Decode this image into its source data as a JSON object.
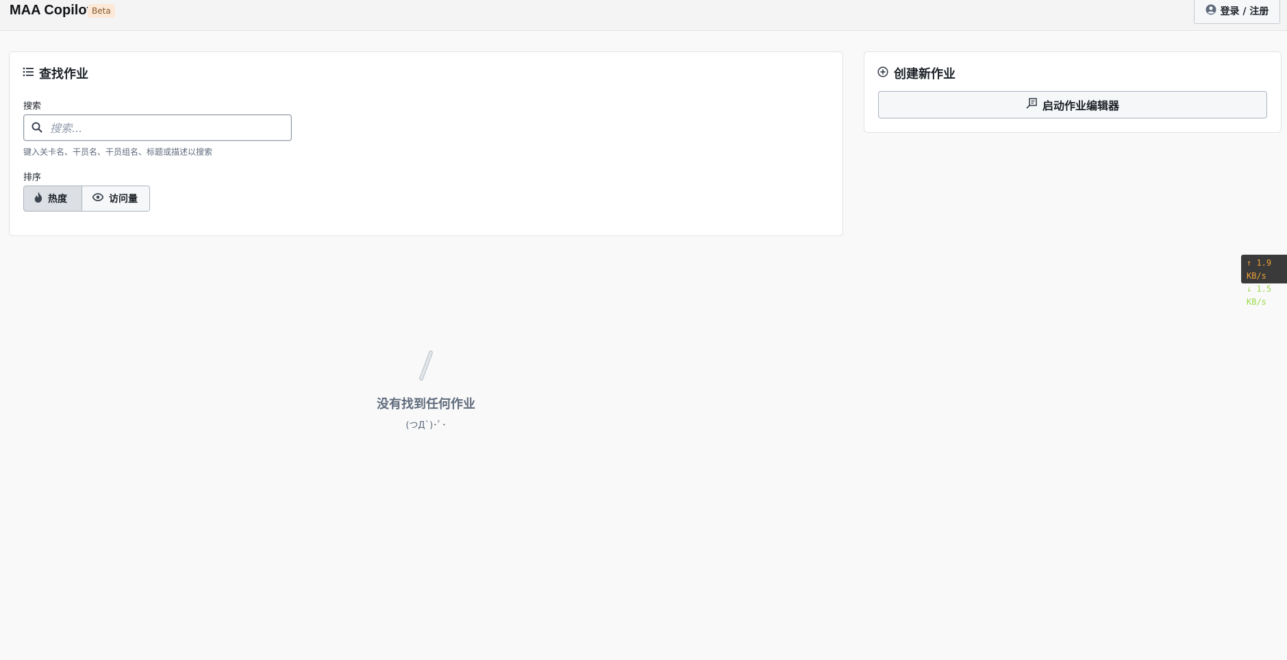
{
  "navbar": {
    "title": "MAA Copilot",
    "badge": "Beta",
    "login_label": "登录 / 注册"
  },
  "find_card": {
    "title": "查找作业",
    "search_label": "搜索",
    "search_placeholder": "搜索...",
    "search_value": "",
    "help_text": "键入关卡名、干员名、干员组名、标题或描述以搜索",
    "sort_label": "排序",
    "sort_options": [
      {
        "label": "热度",
        "icon": "flame-icon",
        "selected": true
      },
      {
        "label": "访问量",
        "icon": "eye-icon",
        "selected": false
      }
    ]
  },
  "create_card": {
    "title": "创建新作业",
    "editor_button_label": "启动作业编辑器"
  },
  "empty_state": {
    "title": "没有找到任何作业",
    "subtitle": "(つД`)･ﾟ･"
  },
  "network_widget": {
    "upload": "↑ 1.9 KB/s",
    "download": "↓ 1.5 KB/s"
  },
  "colors": {
    "upload": "#f0a23a",
    "download": "#9ad94a",
    "muted_text": "#5f6b7c"
  }
}
